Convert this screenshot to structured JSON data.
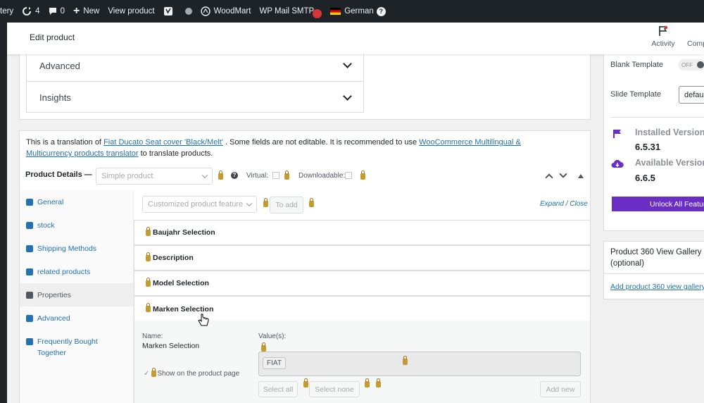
{
  "admin_bar": {
    "items": [
      {
        "label": "tery",
        "icon": ""
      },
      {
        "label": "4",
        "icon": "updates-icon"
      },
      {
        "label": "0",
        "icon": "comment-icon"
      },
      {
        "label": "New",
        "icon": "plus-icon"
      },
      {
        "label": "View product",
        "icon": ""
      },
      {
        "label": "",
        "icon": "yoast-icon"
      },
      {
        "label": "",
        "icon": "status-dot-icon"
      },
      {
        "label": "WoodMart",
        "icon": "woodmart-icon"
      },
      {
        "label": "WP Mail SMTP",
        "icon": "alert-badge-icon"
      },
      {
        "label": "German",
        "icon": "german-flag-icon"
      }
    ]
  },
  "header": {
    "title": "Edit product",
    "activity_label": "Activity",
    "comp_label": "Comp"
  },
  "accordions": [
    {
      "label": "Advanced"
    },
    {
      "label": "Insights"
    }
  ],
  "notice": {
    "prefix": "This is a translation of ",
    "product_link": "Fiat Ducato Seat cover 'Black/Melt'",
    "middle": " . Some fields are not editable. It is recommended to use ",
    "plugin_link": "WooCommerce Multilingual & Multicurrency products translator",
    "suffix": " to translate products."
  },
  "product_details": {
    "label": "Product Details —",
    "type_value": "Simple product",
    "virtual_label": "Virtual:",
    "downloadable_label": "Downloadable:"
  },
  "tabs": [
    {
      "label": "General",
      "icon": "wrench-icon"
    },
    {
      "label": "stock",
      "icon": "tag-icon"
    },
    {
      "label": "Shipping Methods",
      "icon": "truck-icon"
    },
    {
      "label": "related products",
      "icon": "link-icon"
    },
    {
      "label": "Properties",
      "icon": "list-icon",
      "active": true
    },
    {
      "label": "Advanced",
      "icon": "gear-icon"
    },
    {
      "label": "Frequently Bought Together",
      "icon": "bag-icon"
    }
  ],
  "attributes_toolbar": {
    "feature_select": "Customized product feature",
    "add_button": "To add",
    "expand": "Expand",
    "separator": "/",
    "close": "Close"
  },
  "attributes": [
    {
      "label": "Baujahr Selection"
    },
    {
      "label": "Description"
    },
    {
      "label": "Model Selection"
    },
    {
      "label": "Marken Selection"
    }
  ],
  "attribute_detail": {
    "name_label": "Name:",
    "name_value": "Marken Selection",
    "values_label": "Value(s):",
    "value_token": "FIAT",
    "show_label": "Show on the product page",
    "select_all": "Select all",
    "select_none": "Select none",
    "add_new": "Add new"
  },
  "sidebar": {
    "blank_template": "Blank Template",
    "toggle_value": "OFF",
    "slide_template": "Slide Template",
    "slide_select": "defaul",
    "installed_label": "Installed Version",
    "installed_version": "6.5.31",
    "available_label": "Available Version",
    "available_version": "6.6.5",
    "unlock_button": "Unlock All Features",
    "gallery_title": "Product 360 View Gallery (optional)",
    "gallery_link": "Add product 360 view gallery"
  },
  "colors": {
    "admin_bar": "#1d2327",
    "link": "#2271b1",
    "accent_purple": "#6a2ec5",
    "lock": "#c69b2e"
  }
}
